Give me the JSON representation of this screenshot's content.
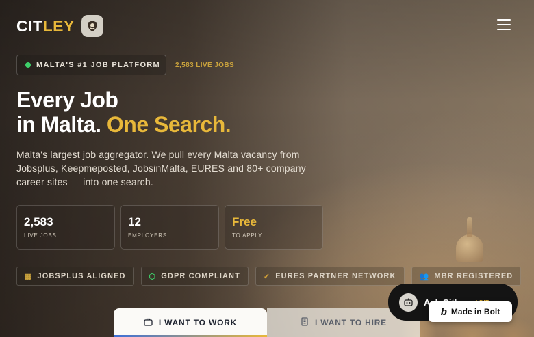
{
  "brand": {
    "name_part1": "CIT",
    "name_part2": "LEY",
    "badge_icon": "shield-crest-icon"
  },
  "header": {
    "menu_icon": "hamburger-menu-icon"
  },
  "hero": {
    "pill": "MALTA'S #1 JOB PLATFORM",
    "live_jobs": "2,583 LIVE JOBS",
    "title_line1": "Every Job",
    "title_line2_a": "in Malta.",
    "title_line2_b": "One Search.",
    "description": "Malta's largest job aggregator. We pull every Malta vacancy from Jobsplus, Keepmeposted, JobsinMalta, EURES and 80+ company career sites — into one search."
  },
  "stats": [
    {
      "value": "2,583",
      "label": "LIVE JOBS"
    },
    {
      "value": "12",
      "label": "EMPLOYERS"
    },
    {
      "value": "Free",
      "label": "TO APPLY"
    }
  ],
  "badges": [
    {
      "label": "JOBSPLUS ALIGNED",
      "icon": "building-icon"
    },
    {
      "label": "GDPR COMPLIANT",
      "icon": "shield-check-icon"
    },
    {
      "label": "EURES PARTNER NETWORK",
      "icon": "check-circle-icon"
    },
    {
      "label": "MBR REGISTERED",
      "icon": "users-icon"
    }
  ],
  "tabs": [
    {
      "label": "I WANT TO WORK",
      "icon": "briefcase-icon",
      "active": true
    },
    {
      "label": "I WANT TO HIRE",
      "icon": "office-building-icon",
      "active": false
    }
  ],
  "assistant": {
    "label": "Ask Citley",
    "status": "LIVE"
  },
  "bolt": {
    "label": "Made in Bolt"
  },
  "colors": {
    "accent": "#e8b83a",
    "live_dot": "#3ecf6a",
    "tab_underline": "#3c6fd8"
  }
}
